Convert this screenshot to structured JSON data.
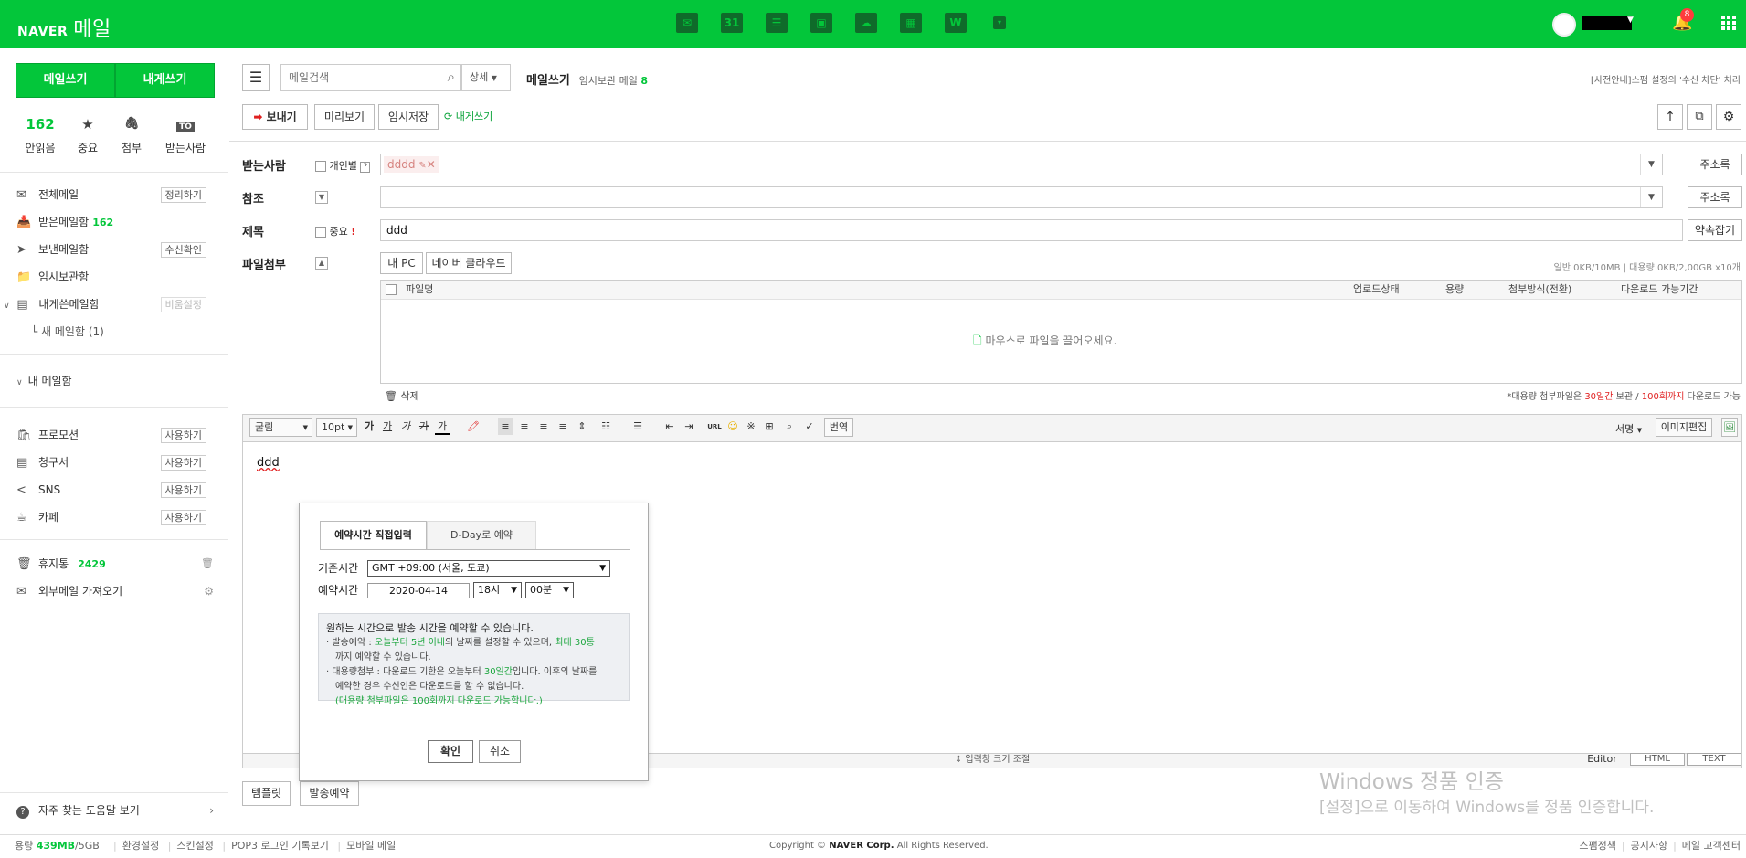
{
  "header": {
    "brand": "NAVER",
    "app_name": "메일",
    "notification_count": "8"
  },
  "services": [
    {
      "name": "mail-service-icon",
      "glyph": "✉"
    },
    {
      "name": "calendar-service-icon",
      "glyph": "31"
    },
    {
      "name": "memo-service-icon",
      "glyph": "☰"
    },
    {
      "name": "contacts-service-icon",
      "glyph": "▣"
    },
    {
      "name": "cloud-service-icon",
      "glyph": "☁"
    },
    {
      "name": "office-service-icon",
      "glyph": "▦"
    },
    {
      "name": "docs-service-icon",
      "glyph": "W"
    },
    {
      "name": "more-service-icon",
      "glyph": "▾"
    }
  ],
  "sidebar": {
    "compose_label": "메일쓰기",
    "self_compose_label": "내게쓰기",
    "quick": [
      {
        "top": "162",
        "label": "안읽음"
      },
      {
        "top": "★",
        "label": "중요"
      },
      {
        "top": "🖇",
        "label": "첨부"
      },
      {
        "top": "TO",
        "label": "받는사람"
      }
    ],
    "folders": [
      {
        "icon": "✉",
        "label": "전체메일",
        "count": "",
        "action": "정리하기"
      },
      {
        "icon": "📥",
        "label": "받은메일함",
        "count": "162",
        "action": ""
      },
      {
        "icon": "➤",
        "label": "보낸메일함",
        "count": "",
        "action": "수신확인"
      },
      {
        "icon": "📁",
        "label": "임시보관함",
        "count": "",
        "action": ""
      },
      {
        "icon": "▤",
        "label": "내게쓴메일함",
        "count": "",
        "action": "비움설정"
      },
      {
        "icon": "",
        "label": "└ 새 메일함 (1)",
        "count": "",
        "action": ""
      }
    ],
    "my_mailbox_label": "내 메일함",
    "apps": [
      {
        "icon": "🛍",
        "label": "프로모션",
        "action": "사용하기"
      },
      {
        "icon": "▤",
        "label": "청구서",
        "action": "사용하기"
      },
      {
        "icon": "<",
        "label": "SNS",
        "action": "사용하기"
      },
      {
        "icon": "☕",
        "label": "카페",
        "action": "사용하기"
      }
    ],
    "trash_label": "휴지통",
    "trash_count": "2429",
    "external_label": "외부메일 가져오기",
    "help_label": "자주 찾는 도움말 보기"
  },
  "topbar": {
    "search_placeholder": "메일검색",
    "detail_label": "상세",
    "title": "메일쓰기",
    "drafts_label": "임시보관 메일",
    "drafts_count": "8",
    "notice": "[사전안내]스팸 설정의 '수신 차단' 처리"
  },
  "toolbar": {
    "send": "보내기",
    "preview": "미리보기",
    "save_draft": "임시저장",
    "self_write": "내게쓰기"
  },
  "form": {
    "to_label": "받는사람",
    "individual_label": "개인별",
    "help_mark": "?",
    "recipient_chip": "dddd",
    "address_book": "주소록",
    "cc_label": "참조",
    "subject_label": "제목",
    "important_label": "중요",
    "subject_value": "ddd",
    "signature_label": "약속잡기",
    "attach_label": "파일첨부",
    "my_pc": "내 PC",
    "naver_cloud": "네이버 클라우드",
    "quota_text": "일반 0KB/10MB  |  대용량 0KB/2,00GB x10개",
    "file_table_headers": [
      "파일명",
      "업로드상태",
      "용량",
      "첨부방식(전환)",
      "다운로드 가능기간"
    ],
    "drop_hint": "마우스로 파일을 끌어오세요.",
    "delete_label": "삭제",
    "large_notice_prefix": "*대용량 첨부파일은 ",
    "large_notice_days": "30일간",
    "large_notice_mid": " 보관 / ",
    "large_notice_count": "100회까지",
    "large_notice_suffix": " 다운로드 가능"
  },
  "editor": {
    "font": "굴림",
    "size": "10pt",
    "translate": "번역",
    "signature": "서명",
    "image_edit": "이미지편집",
    "body_text": "ddd",
    "resize_label": "입력창 크기 조절",
    "modes": [
      "Editor",
      "HTML",
      "TEXT"
    ]
  },
  "modal": {
    "tab_direct": "예약시간 직접입력",
    "tab_dday": "D-Day로 예약",
    "timezone_label": "기준시간",
    "timezone_value": "GMT +09:00 (서울, 도쿄)",
    "schedule_label": "예약시간",
    "date_value": "2020-04-14",
    "hour_value": "18시",
    "minute_value": "00분",
    "info_title": "원하는 시간으로 발송 시간을 예약할 수 있습니다.",
    "info1_a": "· 발송예약 : ",
    "info1_b": "오늘부터 5년 이내",
    "info1_c": "의 날짜를 설정할 수 있으며, ",
    "info1_d": "최대 30통",
    "info1_e": "까지 예약할 수 있습니다.",
    "info2_a": "· 대용량첨부 : 다운로드 기한은 오늘부터 ",
    "info2_b": "30일간",
    "info2_c": "입니다. 이후의 날짜를",
    "info2_d": "예약한 경우 수신인은 다운로드를 할 수 없습니다.",
    "info3": "(대용량 첨부파일은 100회까지 다운로드 가능합니다.)",
    "confirm": "확인",
    "cancel": "취소"
  },
  "bottom_buttons": {
    "template": "템플릿",
    "schedule": "발송예약"
  },
  "watermark": {
    "line1": "Windows 정품 인증",
    "line2": "[설정]으로 이동하여 Windows를 정품 인증합니다."
  },
  "footer": {
    "capacity_label": "용량",
    "capacity_used": "439MB",
    "capacity_total": "/5GB",
    "links": [
      "환경설정",
      "스킨설정",
      "POP3 로그인 기록보기",
      "모바일 메일"
    ],
    "copyright_prefix": "Copyright ©",
    "copyright_corp": "NAVER Corp.",
    "copyright_suffix": "All Rights Reserved.",
    "right_links": [
      "스팸정책",
      "공지사항",
      "메일 고객센터"
    ]
  },
  "colors": {
    "brand": "#03c63a",
    "accent_red": "#e02020"
  }
}
